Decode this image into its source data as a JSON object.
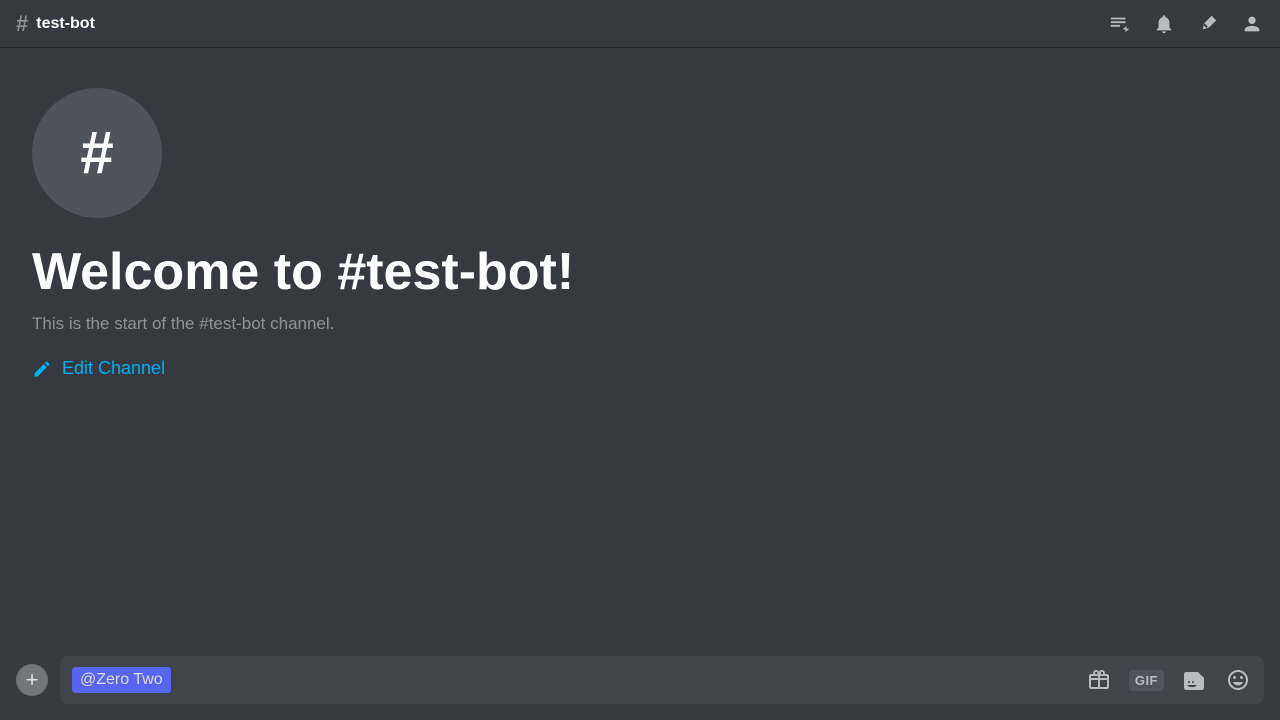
{
  "header": {
    "channel_hash": "#",
    "channel_name": "test-bot",
    "icons": {
      "threads": "threads-icon",
      "bell": "bell-icon",
      "pin": "pin-icon",
      "members": "members-icon"
    }
  },
  "main": {
    "channel_icon": "#",
    "welcome_title": "Welcome to #test-bot!",
    "welcome_subtitle": "This is the start of the #test-bot channel.",
    "edit_channel_label": "Edit Channel"
  },
  "message_bar": {
    "add_button_label": "+",
    "input_text": "@Zero Two",
    "icons": {
      "gift": "gift-icon",
      "gif": "GIF",
      "sticker": "sticker-icon",
      "emoji": "emoji-icon"
    }
  }
}
